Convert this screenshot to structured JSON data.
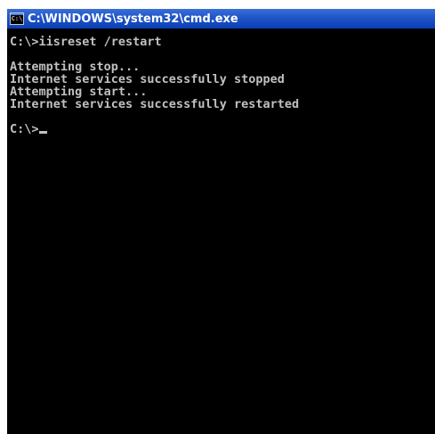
{
  "window": {
    "title": "C:\\WINDOWS\\system32\\cmd.exe",
    "icon": "cmd-icon",
    "icon_text": "C:\\"
  },
  "console": {
    "lines": [
      "C:\\>iisreset /restart",
      "",
      "Attempting stop...",
      "Internet services successfully stopped",
      "Attempting start...",
      "Internet services successfully restarted",
      "",
      "C:\\>"
    ]
  },
  "colors": {
    "titlebar": "#1f54c8",
    "background": "#000000",
    "text": "#c0c0c0"
  }
}
